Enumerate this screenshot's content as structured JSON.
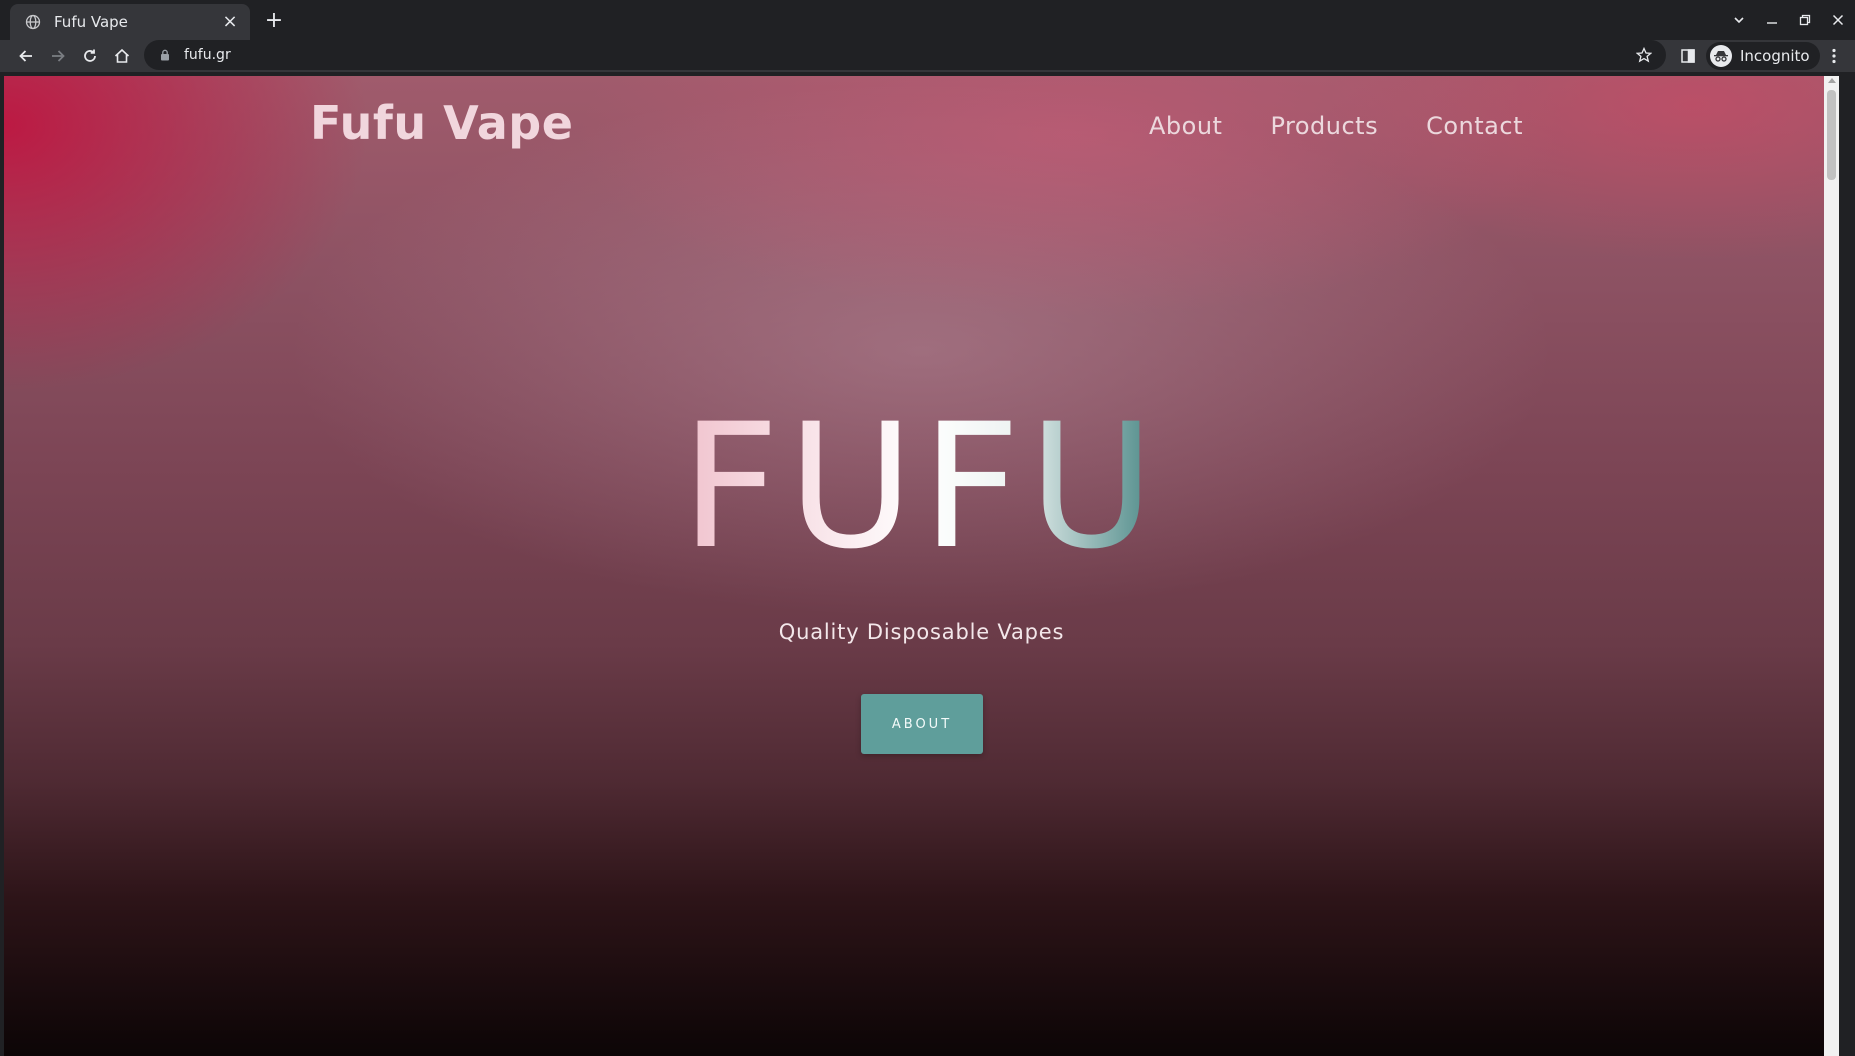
{
  "browser": {
    "tab": {
      "title": "Fufu Vape",
      "favicon": "globe-icon",
      "close": "×"
    },
    "new_tab": "+",
    "window_controls": {
      "minimize": "—",
      "restore": "❐",
      "close": "✕"
    },
    "address": {
      "url": "fufu.gr"
    },
    "profile": {
      "label": "Incognito"
    }
  },
  "site": {
    "brand": "Fufu Vape",
    "nav": [
      "About",
      "Products",
      "Contact"
    ],
    "hero": {
      "title": "FUFU",
      "subtitle": "Quality Disposable Vapes",
      "cta": "ABOUT"
    }
  },
  "colors": {
    "accent": "#5f9e9b",
    "brand_pink": "#f1d6dd",
    "hero_red": "#be1641"
  }
}
